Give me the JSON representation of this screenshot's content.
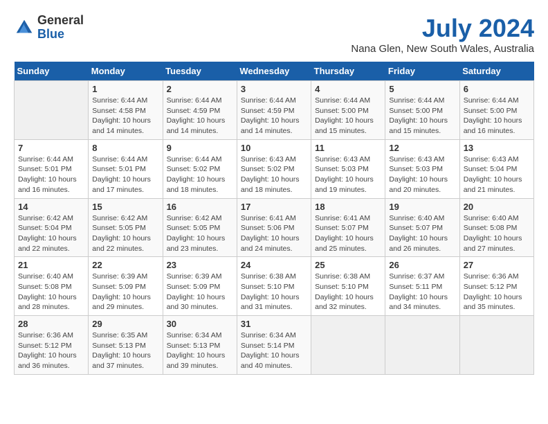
{
  "header": {
    "logo_general": "General",
    "logo_blue": "Blue",
    "month": "July 2024",
    "location": "Nana Glen, New South Wales, Australia"
  },
  "weekdays": [
    "Sunday",
    "Monday",
    "Tuesday",
    "Wednesday",
    "Thursday",
    "Friday",
    "Saturday"
  ],
  "weeks": [
    [
      {
        "day": "",
        "info": ""
      },
      {
        "day": "1",
        "info": "Sunrise: 6:44 AM\nSunset: 4:58 PM\nDaylight: 10 hours\nand 14 minutes."
      },
      {
        "day": "2",
        "info": "Sunrise: 6:44 AM\nSunset: 4:59 PM\nDaylight: 10 hours\nand 14 minutes."
      },
      {
        "day": "3",
        "info": "Sunrise: 6:44 AM\nSunset: 4:59 PM\nDaylight: 10 hours\nand 14 minutes."
      },
      {
        "day": "4",
        "info": "Sunrise: 6:44 AM\nSunset: 5:00 PM\nDaylight: 10 hours\nand 15 minutes."
      },
      {
        "day": "5",
        "info": "Sunrise: 6:44 AM\nSunset: 5:00 PM\nDaylight: 10 hours\nand 15 minutes."
      },
      {
        "day": "6",
        "info": "Sunrise: 6:44 AM\nSunset: 5:00 PM\nDaylight: 10 hours\nand 16 minutes."
      }
    ],
    [
      {
        "day": "7",
        "info": "Sunrise: 6:44 AM\nSunset: 5:01 PM\nDaylight: 10 hours\nand 16 minutes."
      },
      {
        "day": "8",
        "info": "Sunrise: 6:44 AM\nSunset: 5:01 PM\nDaylight: 10 hours\nand 17 minutes."
      },
      {
        "day": "9",
        "info": "Sunrise: 6:44 AM\nSunset: 5:02 PM\nDaylight: 10 hours\nand 18 minutes."
      },
      {
        "day": "10",
        "info": "Sunrise: 6:43 AM\nSunset: 5:02 PM\nDaylight: 10 hours\nand 18 minutes."
      },
      {
        "day": "11",
        "info": "Sunrise: 6:43 AM\nSunset: 5:03 PM\nDaylight: 10 hours\nand 19 minutes."
      },
      {
        "day": "12",
        "info": "Sunrise: 6:43 AM\nSunset: 5:03 PM\nDaylight: 10 hours\nand 20 minutes."
      },
      {
        "day": "13",
        "info": "Sunrise: 6:43 AM\nSunset: 5:04 PM\nDaylight: 10 hours\nand 21 minutes."
      }
    ],
    [
      {
        "day": "14",
        "info": "Sunrise: 6:42 AM\nSunset: 5:04 PM\nDaylight: 10 hours\nand 22 minutes."
      },
      {
        "day": "15",
        "info": "Sunrise: 6:42 AM\nSunset: 5:05 PM\nDaylight: 10 hours\nand 22 minutes."
      },
      {
        "day": "16",
        "info": "Sunrise: 6:42 AM\nSunset: 5:05 PM\nDaylight: 10 hours\nand 23 minutes."
      },
      {
        "day": "17",
        "info": "Sunrise: 6:41 AM\nSunset: 5:06 PM\nDaylight: 10 hours\nand 24 minutes."
      },
      {
        "day": "18",
        "info": "Sunrise: 6:41 AM\nSunset: 5:07 PM\nDaylight: 10 hours\nand 25 minutes."
      },
      {
        "day": "19",
        "info": "Sunrise: 6:40 AM\nSunset: 5:07 PM\nDaylight: 10 hours\nand 26 minutes."
      },
      {
        "day": "20",
        "info": "Sunrise: 6:40 AM\nSunset: 5:08 PM\nDaylight: 10 hours\nand 27 minutes."
      }
    ],
    [
      {
        "day": "21",
        "info": "Sunrise: 6:40 AM\nSunset: 5:08 PM\nDaylight: 10 hours\nand 28 minutes."
      },
      {
        "day": "22",
        "info": "Sunrise: 6:39 AM\nSunset: 5:09 PM\nDaylight: 10 hours\nand 29 minutes."
      },
      {
        "day": "23",
        "info": "Sunrise: 6:39 AM\nSunset: 5:09 PM\nDaylight: 10 hours\nand 30 minutes."
      },
      {
        "day": "24",
        "info": "Sunrise: 6:38 AM\nSunset: 5:10 PM\nDaylight: 10 hours\nand 31 minutes."
      },
      {
        "day": "25",
        "info": "Sunrise: 6:38 AM\nSunset: 5:10 PM\nDaylight: 10 hours\nand 32 minutes."
      },
      {
        "day": "26",
        "info": "Sunrise: 6:37 AM\nSunset: 5:11 PM\nDaylight: 10 hours\nand 34 minutes."
      },
      {
        "day": "27",
        "info": "Sunrise: 6:36 AM\nSunset: 5:12 PM\nDaylight: 10 hours\nand 35 minutes."
      }
    ],
    [
      {
        "day": "28",
        "info": "Sunrise: 6:36 AM\nSunset: 5:12 PM\nDaylight: 10 hours\nand 36 minutes."
      },
      {
        "day": "29",
        "info": "Sunrise: 6:35 AM\nSunset: 5:13 PM\nDaylight: 10 hours\nand 37 minutes."
      },
      {
        "day": "30",
        "info": "Sunrise: 6:34 AM\nSunset: 5:13 PM\nDaylight: 10 hours\nand 39 minutes."
      },
      {
        "day": "31",
        "info": "Sunrise: 6:34 AM\nSunset: 5:14 PM\nDaylight: 10 hours\nand 40 minutes."
      },
      {
        "day": "",
        "info": ""
      },
      {
        "day": "",
        "info": ""
      },
      {
        "day": "",
        "info": ""
      }
    ]
  ]
}
